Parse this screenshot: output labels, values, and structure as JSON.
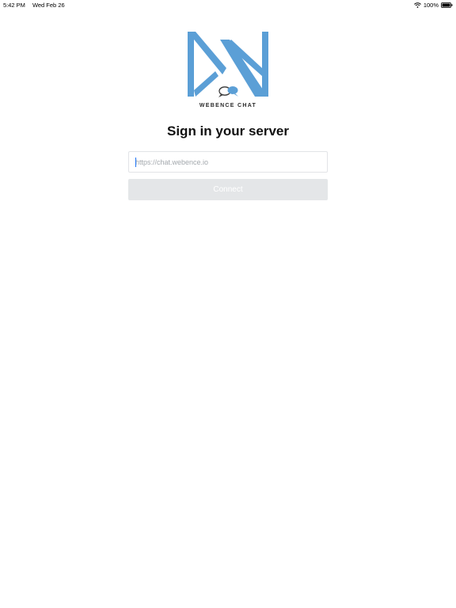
{
  "status_bar": {
    "time": "5:42 PM",
    "date": "Wed Feb 26",
    "battery": "100%",
    "icons": [
      "wifi-icon",
      "battery-icon"
    ]
  },
  "brand": {
    "name": "WEBENCE CHAT",
    "logo_color": "#5b9fd6"
  },
  "signin": {
    "title": "Sign in your server",
    "server_placeholder": "https://chat.webence.io",
    "server_value": "",
    "connect_label": "Connect"
  },
  "colors": {
    "button_disabled_bg": "#e4e6e8",
    "caret": "#1d74f5"
  }
}
